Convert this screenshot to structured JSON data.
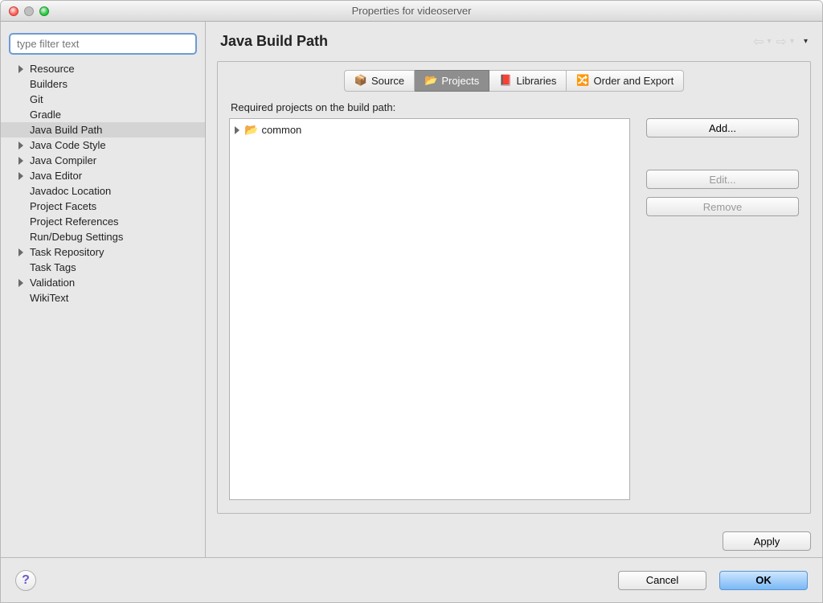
{
  "window_title": "Properties for videoserver",
  "filter_placeholder": "type filter text",
  "sidebar": {
    "items": [
      {
        "label": "Resource",
        "children": true,
        "selected": false
      },
      {
        "label": "Builders",
        "children": false,
        "selected": false
      },
      {
        "label": "Git",
        "children": false,
        "selected": false
      },
      {
        "label": "Gradle",
        "children": false,
        "selected": false
      },
      {
        "label": "Java Build Path",
        "children": false,
        "selected": true
      },
      {
        "label": "Java Code Style",
        "children": true,
        "selected": false
      },
      {
        "label": "Java Compiler",
        "children": true,
        "selected": false
      },
      {
        "label": "Java Editor",
        "children": true,
        "selected": false
      },
      {
        "label": "Javadoc Location",
        "children": false,
        "selected": false
      },
      {
        "label": "Project Facets",
        "children": false,
        "selected": false
      },
      {
        "label": "Project References",
        "children": false,
        "selected": false
      },
      {
        "label": "Run/Debug Settings",
        "children": false,
        "selected": false
      },
      {
        "label": "Task Repository",
        "children": true,
        "selected": false
      },
      {
        "label": "Task Tags",
        "children": false,
        "selected": false
      },
      {
        "label": "Validation",
        "children": true,
        "selected": false
      },
      {
        "label": "WikiText",
        "children": false,
        "selected": false
      }
    ]
  },
  "header": {
    "title": "Java Build Path"
  },
  "tabs": [
    {
      "label": "Source",
      "icon": "📦",
      "selected": false
    },
    {
      "label": "Projects",
      "icon": "📂",
      "selected": true
    },
    {
      "label": "Libraries",
      "icon": "📕",
      "selected": false
    },
    {
      "label": "Order and Export",
      "icon": "🔀",
      "selected": false
    }
  ],
  "section_label": "Required projects on the build path:",
  "projects": [
    {
      "name": "common"
    }
  ],
  "right_buttons": {
    "add": "Add...",
    "edit": "Edit...",
    "remove": "Remove"
  },
  "apply": "Apply",
  "footer": {
    "cancel": "Cancel",
    "ok": "OK"
  }
}
